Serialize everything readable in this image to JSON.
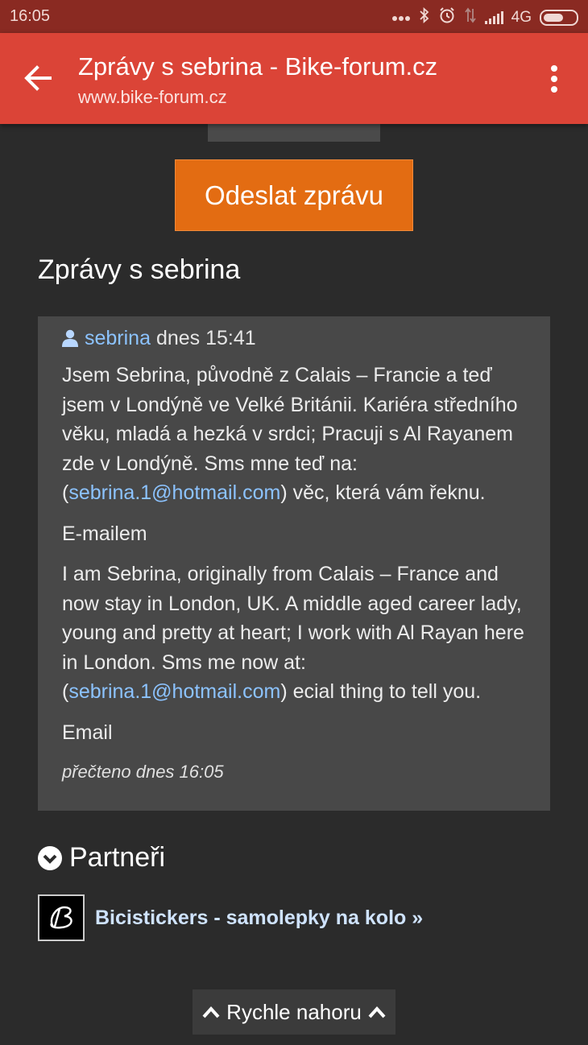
{
  "status_bar": {
    "time": "16:05",
    "network": "4G",
    "icons": [
      "more-dots-icon",
      "bluetooth-icon",
      "alarm-icon",
      "data-arrows-icon",
      "signal-icon",
      "battery-icon"
    ]
  },
  "app_bar": {
    "title": "Zprávy s sebrina - Bike-forum.cz",
    "url": "www.bike-forum.cz",
    "back_icon": "back-arrow-icon",
    "menu_icon": "overflow-menu-icon",
    "color": "#db4437"
  },
  "send_button": {
    "label": "Odeslat zprávu",
    "color": "#e36c12"
  },
  "conversation": {
    "title": "Zprávy s sebrina",
    "message": {
      "author": "sebrina",
      "time": "dnes 15:41",
      "cz_text_before": "Jsem Sebrina, původně z Calais – Francie a teď jsem v Londýně ve Velké Británii. Kariéra středního věku, mladá a hezká v srdci; Pracuji s Al Rayanem zde v Londýně. Sms mne teď na: (",
      "cz_email": "sebrina.1@hotmail.com",
      "cz_text_after": ") věc, která vám řeknu.",
      "cz_email_label": "E-mailem",
      "en_text_before": "I am Sebrina, originally from Calais – France and now stay in London, UK. A middle aged career lady, young and pretty at heart; I work with Al Rayan here in London. Sms me now at: (",
      "en_email": "sebrina.1@hotmail.com",
      "en_text_after": ") ecial thing to tell you.",
      "en_email_label": "Email",
      "read_status": "přečteno dnes 16:05"
    }
  },
  "partners": {
    "title": "Partneři",
    "items": [
      {
        "label": "Bicistickers - samolepky na kolo »"
      }
    ]
  },
  "back_to_top": {
    "label": "Rychle nahoru"
  }
}
